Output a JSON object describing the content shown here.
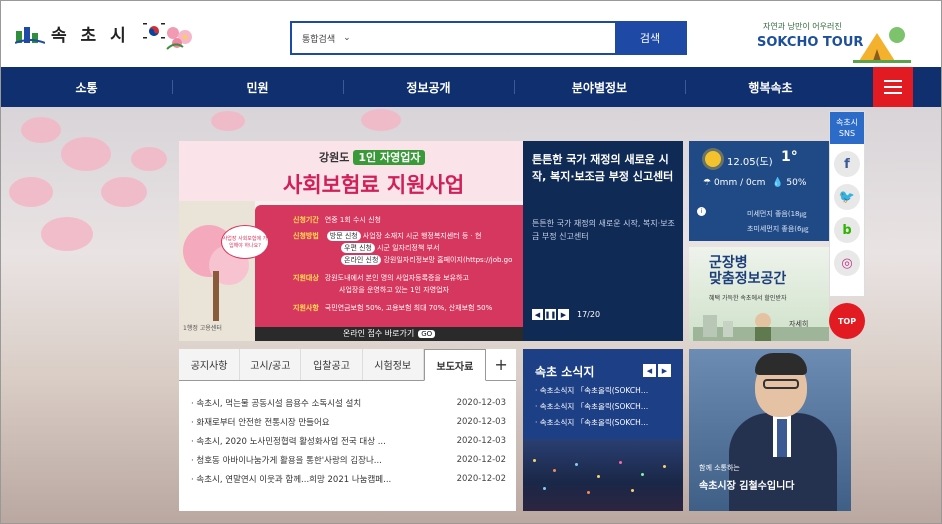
{
  "header": {
    "logo_text": "속 초 시",
    "search": {
      "scope": "통합검색",
      "placeholder": "",
      "button": "검색"
    },
    "tour": {
      "tagline": "자연과 낭만이 어우러진",
      "title": "SOKCHO TOUR"
    }
  },
  "nav": {
    "items": [
      "소통",
      "민원",
      "정보공개",
      "분야별정보",
      "행복속초"
    ]
  },
  "banner": {
    "kicker": "강원도",
    "chip": "1인 자영업자",
    "title": "사회보험료 지원사업",
    "bubble": "사업장 사회보험에 가입해야 하나요?",
    "rows": [
      {
        "label": "신청기간",
        "text": "연중 1회 수시 신청"
      },
      {
        "label": "신청방법",
        "chip": "방문 신청",
        "text": "사업장 소재지 시군 행정복지센터 등 · 현"
      },
      {
        "label": "",
        "chip": "우편 신청",
        "text": "시군 일자리정책 부서"
      },
      {
        "label": "",
        "chip": "온라인 신청",
        "text": "강원일자리정보망 홈페이지(https://job.go"
      },
      {
        "label": "지원대상",
        "text": "강원도내에서 본인 명의 사업자등록증을 보유하고"
      },
      {
        "label": "",
        "text": "사업장을 운영하고 있는 1인 자영업자"
      },
      {
        "label": "지원사항",
        "text": "국민연금보험 50%, 고용보험 최대 70%, 산재보험 50%"
      }
    ],
    "foot": "온라인 접수 바로가기",
    "go": "GO",
    "tree_label": "1행정 고용센터"
  },
  "news": {
    "title": "튼튼한 국가 재정의 새로운 시작, 복지·보조금 부정 신고센터",
    "desc": "튼튼한 국가 재정의 새로운 시작, 복지·보조금 부정 신고센터",
    "page": "17/20"
  },
  "weather": {
    "date": "12.05(도)",
    "temp": "1°",
    "rain": "0mm / 0cm",
    "humidity": "50%",
    "dust1": "미세먼지  좋음(18㎍",
    "dust2": "초미세먼지  좋음(6㎍"
  },
  "military": {
    "title1": "군장병",
    "title2": "맞춤정보공간",
    "sub": "혜택 가득한 속초에서 할인받자",
    "more": "자세히"
  },
  "sns": {
    "title": "속초시 SNS",
    "top": "TOP"
  },
  "notice": {
    "tabs": [
      "공지사항",
      "고시/공고",
      "입찰공고",
      "시험정보",
      "보도자료"
    ],
    "active": 4,
    "plus": "+",
    "rows": [
      {
        "title": "· 속초시, 먹는물 공동시설 음용수 소독시설 설치",
        "date": "2020-12-03"
      },
      {
        "title": "· 화재로부터 안전한 전통시장 만들어요",
        "date": "2020-12-03"
      },
      {
        "title": "· 속초시, 2020 노사민정협력 활성화사업 전국 대상 ...",
        "date": "2020-12-03"
      },
      {
        "title": "· 청호동 아바이나눔가게 활용을 통한'사랑의 김장나...",
        "date": "2020-12-02"
      },
      {
        "title": "· 속초시, 연말연시 이웃과 함께...희망 2021 나눔캠페...",
        "date": "2020-12-02"
      }
    ]
  },
  "sokcho_news": {
    "title": "속초 소식지",
    "items": [
      "· 속초소식지 「속초올릭(SOKCH…",
      "· 속초소식지 「속초올릭(SOKCH…",
      "· 속초소식지 「속초올릭(SOKCH…"
    ]
  },
  "mayor": {
    "small": "함께 소통하는",
    "name": "속초시장 김철수입니다"
  },
  "colors": {
    "nav": "#0f2f6e",
    "accent_red": "#e21a22",
    "brand_blue": "#1e4aa6"
  }
}
